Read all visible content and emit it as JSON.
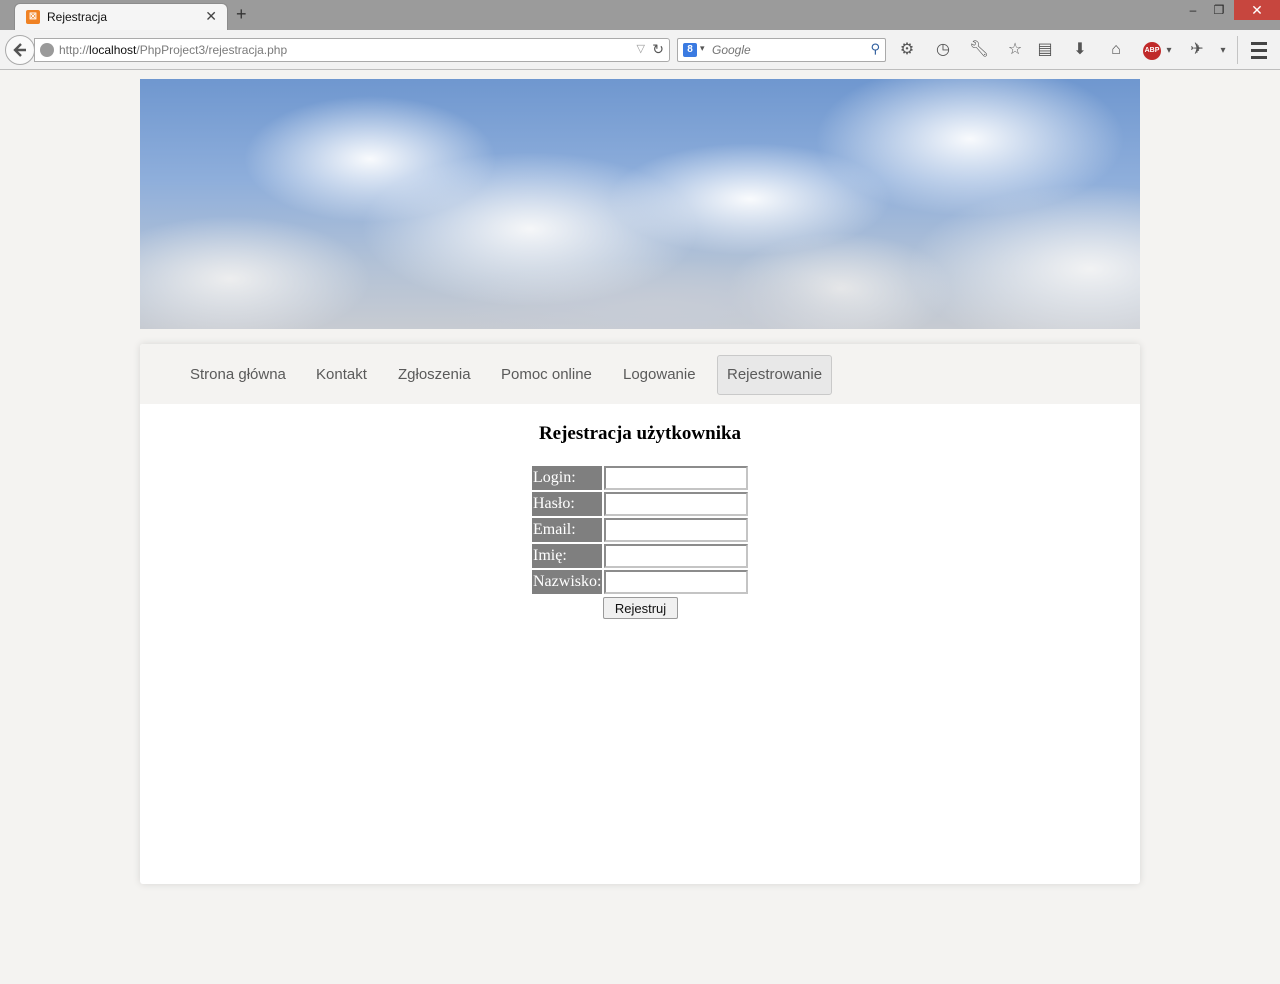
{
  "browser": {
    "tab_title": "Rejestracja",
    "tab_close": "✕",
    "new_tab": "+",
    "favicon_glyph": "⊠",
    "window": {
      "minimize": "–",
      "maximize": "❐",
      "close": "✕"
    },
    "url_scheme": "http://",
    "url_host": "localhost",
    "url_path": "/PhpProject3/rejestracja.php",
    "search_placeholder": "Google",
    "search_engine_glyph": "8",
    "toolbar_icons": [
      "gear-icon",
      "history-icon",
      "wrench-icon",
      "bookmark-star-icon",
      "reader-icon",
      "download-icon",
      "home-icon",
      "adblock-icon",
      "extension-icon",
      "menu-icon"
    ],
    "abp_label": "ABP"
  },
  "nav": {
    "items": [
      {
        "label": "Strona główna",
        "active": false
      },
      {
        "label": "Kontakt",
        "active": false
      },
      {
        "label": "Zgłoszenia",
        "active": false
      },
      {
        "label": "Pomoc online",
        "active": false
      },
      {
        "label": "Logowanie",
        "active": false
      },
      {
        "label": "Rejestrowanie",
        "active": true
      }
    ]
  },
  "form": {
    "title": "Rejestracja użytkownika",
    "fields": [
      {
        "label": "Login:",
        "value": ""
      },
      {
        "label": "Hasło:",
        "value": ""
      },
      {
        "label": "Email:",
        "value": ""
      },
      {
        "label": "Imię:",
        "value": ""
      },
      {
        "label": "Nazwisko:",
        "value": ""
      }
    ],
    "submit_label": "Rejestruj"
  },
  "colors": {
    "label_bg": "#7f7f7f",
    "page_bg": "#f4f3f1",
    "active_tab_bg": "#e8e8e8"
  }
}
